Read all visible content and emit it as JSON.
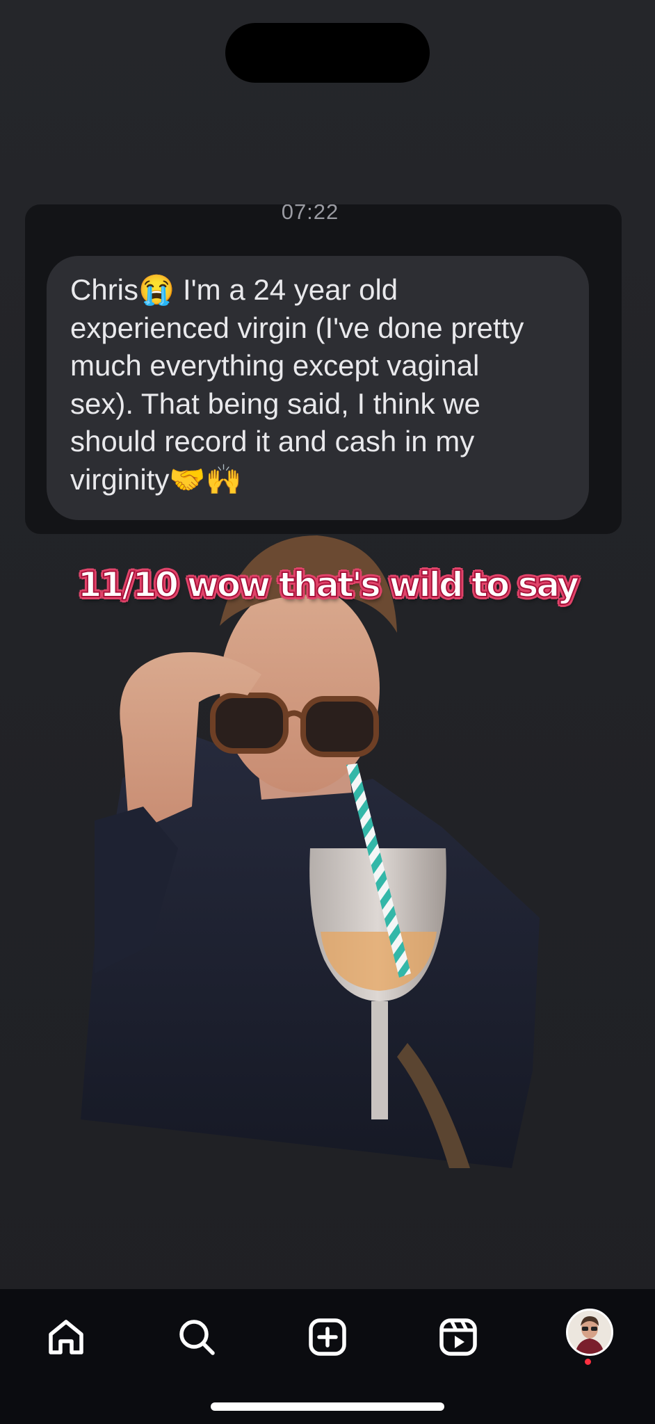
{
  "message": {
    "time": "07:22",
    "text": "Chris😭 I'm a 24 year old\nexperienced virgin (I've done pretty\nmuch everything except vaginal\nsex). That being said, I think we\nshould record it and cash in my\nvirginity🤝🙌"
  },
  "caption": "11/10 wow that's wild to say",
  "photo": {
    "subject": "man in sunglasses sipping from a wine glass with a striped straw"
  },
  "tabbar": {
    "items": [
      {
        "name": "home",
        "icon": "home-icon"
      },
      {
        "name": "search",
        "icon": "search-icon"
      },
      {
        "name": "create",
        "icon": "plus-square-icon"
      },
      {
        "name": "reels",
        "icon": "reels-icon"
      },
      {
        "name": "profile",
        "icon": "profile-avatar"
      }
    ],
    "notification_color": "#ff3040"
  },
  "colors": {
    "background": "#242529",
    "message_bubble": "#2d2e33",
    "caption_outline": "#e0446a"
  }
}
